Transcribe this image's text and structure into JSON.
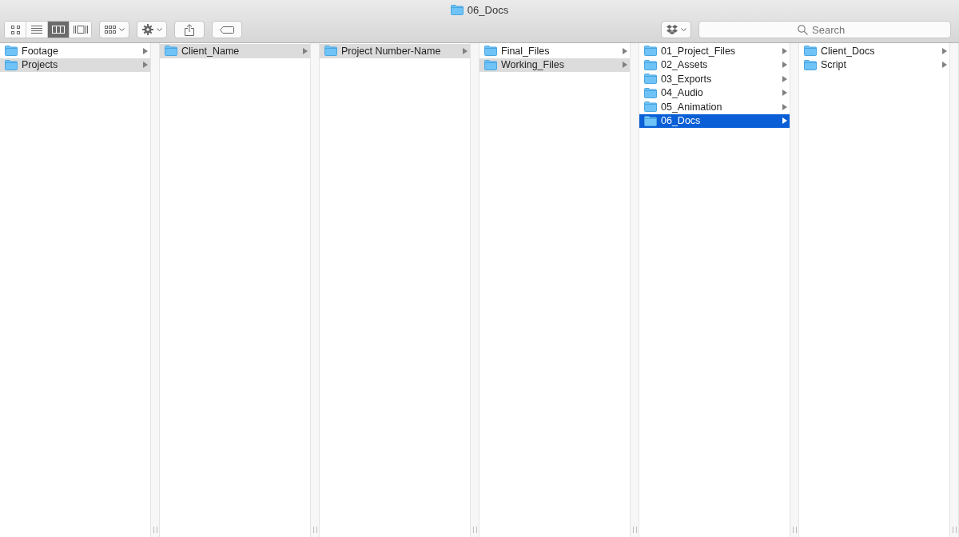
{
  "window": {
    "title": "06_Docs"
  },
  "view_modes": [
    {
      "kind": "icons",
      "selected": false
    },
    {
      "kind": "list",
      "selected": false
    },
    {
      "kind": "columns",
      "selected": true
    },
    {
      "kind": "gallery",
      "selected": false
    }
  ],
  "search": {
    "placeholder": "Search"
  },
  "columns": [
    {
      "items": [
        {
          "name": "Footage",
          "selected": false
        },
        {
          "name": "Projects",
          "selected": true,
          "focused": false
        }
      ]
    },
    {
      "items": [
        {
          "name": "Client_Name",
          "selected": true,
          "focused": false
        }
      ]
    },
    {
      "items": [
        {
          "name": "Project Number-Name",
          "selected": true,
          "focused": false
        }
      ]
    },
    {
      "items": [
        {
          "name": "Final_Files",
          "selected": false
        },
        {
          "name": "Working_Files",
          "selected": true,
          "focused": false
        }
      ]
    },
    {
      "items": [
        {
          "name": "01_Project_Files",
          "selected": false
        },
        {
          "name": "02_Assets",
          "selected": false
        },
        {
          "name": "03_Exports",
          "selected": false
        },
        {
          "name": "04_Audio",
          "selected": false
        },
        {
          "name": "05_Animation",
          "selected": false
        },
        {
          "name": "06_Docs",
          "selected": true,
          "focused": true
        }
      ]
    },
    {
      "items": [
        {
          "name": "Client_Docs",
          "selected": false
        },
        {
          "name": "Script",
          "selected": false
        }
      ]
    }
  ]
}
